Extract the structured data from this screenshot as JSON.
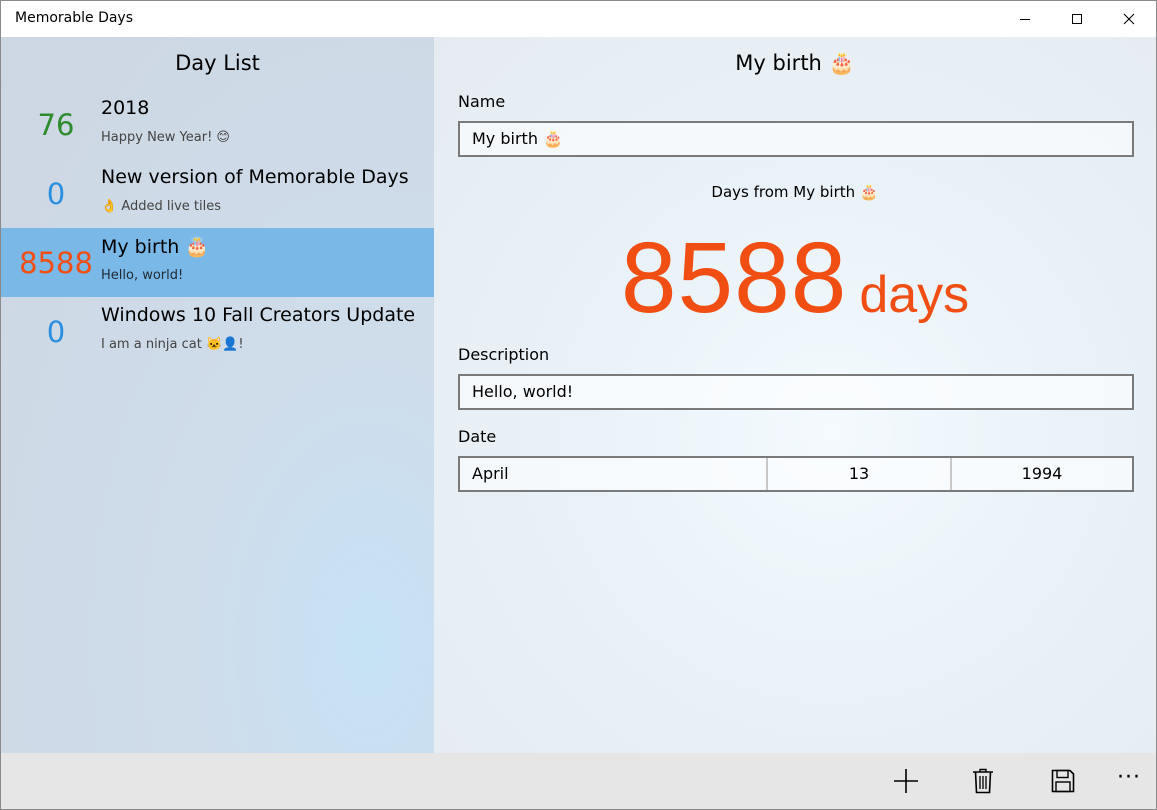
{
  "window": {
    "title": "Memorable Days",
    "minimize_icon": "minimize-icon",
    "maximize_icon": "maximize-icon",
    "close_icon": "close-icon"
  },
  "day_list": {
    "header": "Day List",
    "items": [
      {
        "count": "76",
        "count_color": "#2e8b2e",
        "title": "2018",
        "subtitle": "Happy New Year! 😊",
        "selected": false
      },
      {
        "count": "0",
        "count_color": "#2b8fe0",
        "title": "New version of Memorable Days",
        "subtitle": "👌 Added live tiles",
        "selected": false
      },
      {
        "count": "8588",
        "count_color": "#f04e12",
        "title": "My birth 🎂",
        "subtitle": "Hello, world!",
        "selected": true
      },
      {
        "count": "0",
        "count_color": "#2b8fe0",
        "title": "Windows 10 Fall Creators Update",
        "subtitle": "I am a ninja cat 🐱‍👤!",
        "selected": false
      }
    ]
  },
  "detail": {
    "header": "My birth 🎂",
    "name_label": "Name",
    "name_value": "My birth 🎂",
    "days_from_text": "Days from My birth 🎂",
    "count_number": "8588",
    "count_unit": "days",
    "count_color": "#f04e12",
    "description_label": "Description",
    "description_value": "Hello, world!",
    "date_label": "Date",
    "date_month": "April",
    "date_day": "13",
    "date_year": "1994"
  },
  "command_bar": {
    "add_icon": "plus-icon",
    "delete_icon": "trash-icon",
    "save_icon": "save-icon",
    "more_label": "···"
  },
  "colors": {
    "selected_background": "#7ab8e8",
    "accent_orange": "#f04e12",
    "accent_blue": "#2b8fe0",
    "accent_green": "#2e8b2e"
  }
}
